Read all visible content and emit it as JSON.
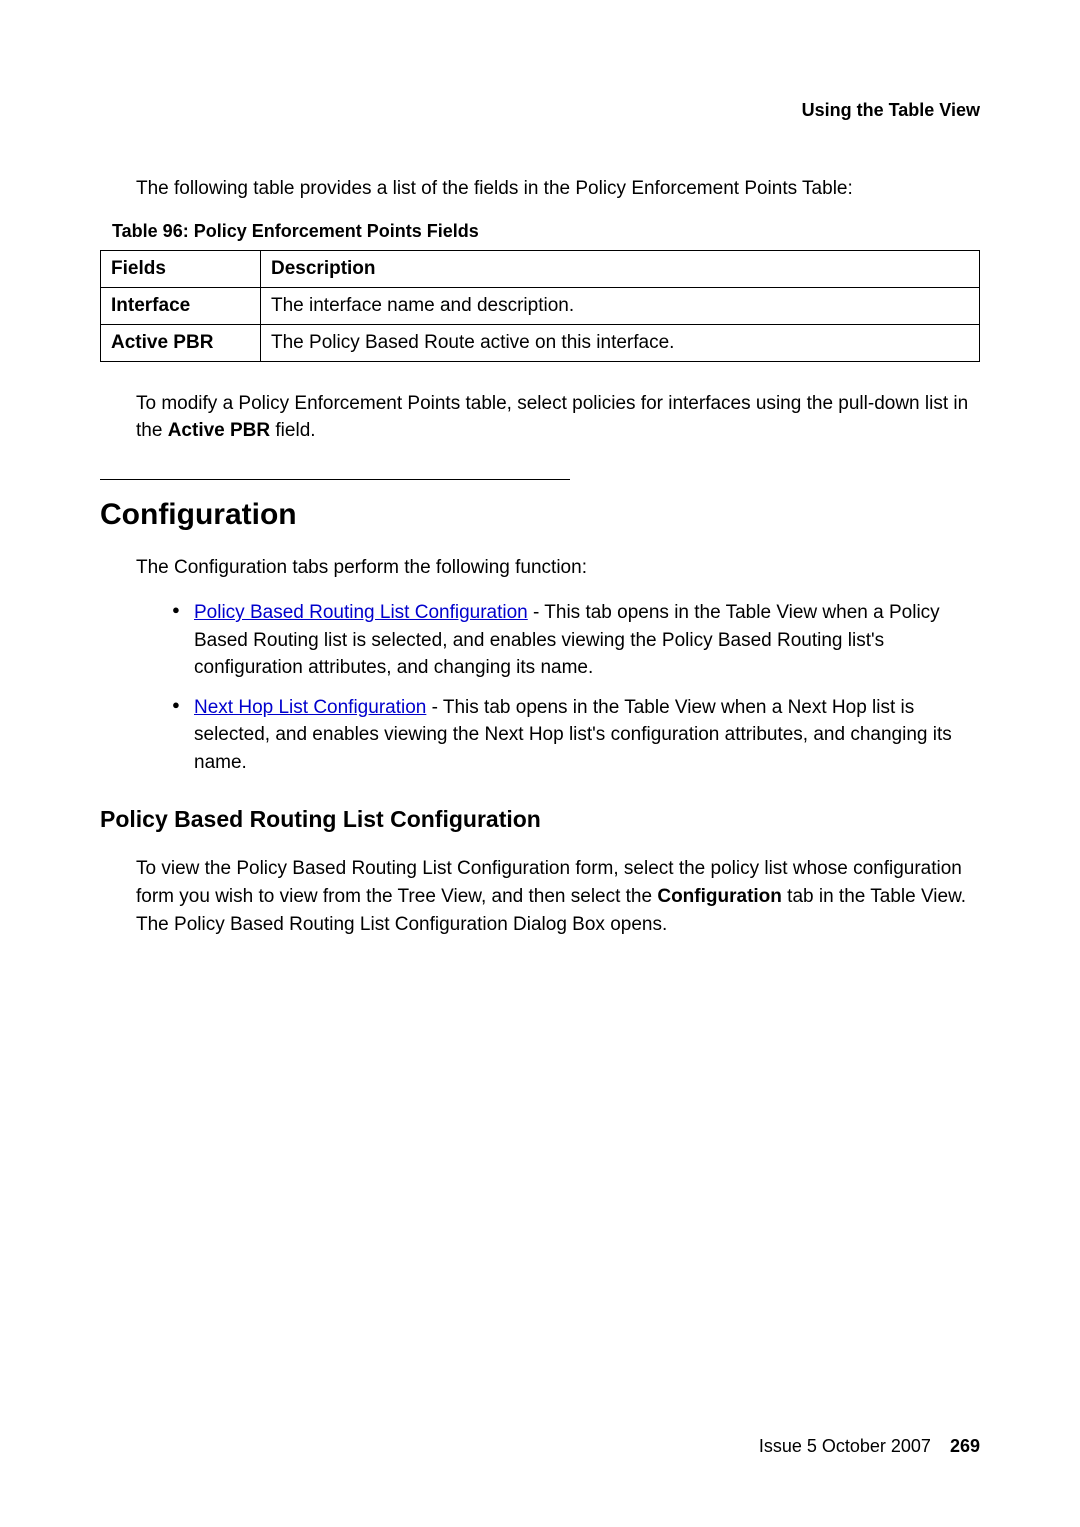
{
  "header": {
    "title": "Using the Table View"
  },
  "intro": "The following table provides a list of the fields in the Policy Enforcement Points Table:",
  "table": {
    "caption": "Table 96: Policy Enforcement Points Fields",
    "head": {
      "c0": "Fields",
      "c1": "Description"
    },
    "rows": [
      {
        "c0": "Interface",
        "c1": "The interface name and description."
      },
      {
        "c0": "Active PBR",
        "c1": "The Policy Based Route active on this interface."
      }
    ]
  },
  "modify_para": {
    "before": "To modify a Policy Enforcement Points table, select policies for interfaces using the pull-down list in the ",
    "bold": "Active PBR",
    "after": " field."
  },
  "config": {
    "heading": "Configuration",
    "intro": "The Configuration tabs perform the following function:",
    "bullets": [
      {
        "link": "Policy Based Routing List Configuration",
        "rest": " - This tab opens in the Table View when a Policy Based Routing list is selected, and enables viewing the Policy Based Routing list's configuration attributes, and changing its name."
      },
      {
        "link": "Next Hop List Configuration",
        "rest": " - This tab opens in the Table View when a Next Hop list is selected, and enables viewing the Next Hop list's configuration attributes, and changing its name."
      }
    ]
  },
  "pbr": {
    "heading": "Policy Based Routing List Configuration",
    "para": {
      "before": "To view the Policy Based Routing List Configuration form, select the policy list whose configuration form you wish to view from the Tree View, and then select the ",
      "bold": "Configuration",
      "after": " tab in the Table View. The Policy Based Routing List Configuration Dialog Box opens."
    }
  },
  "footer": {
    "issue": "Issue 5   October 2007",
    "page": "269"
  }
}
